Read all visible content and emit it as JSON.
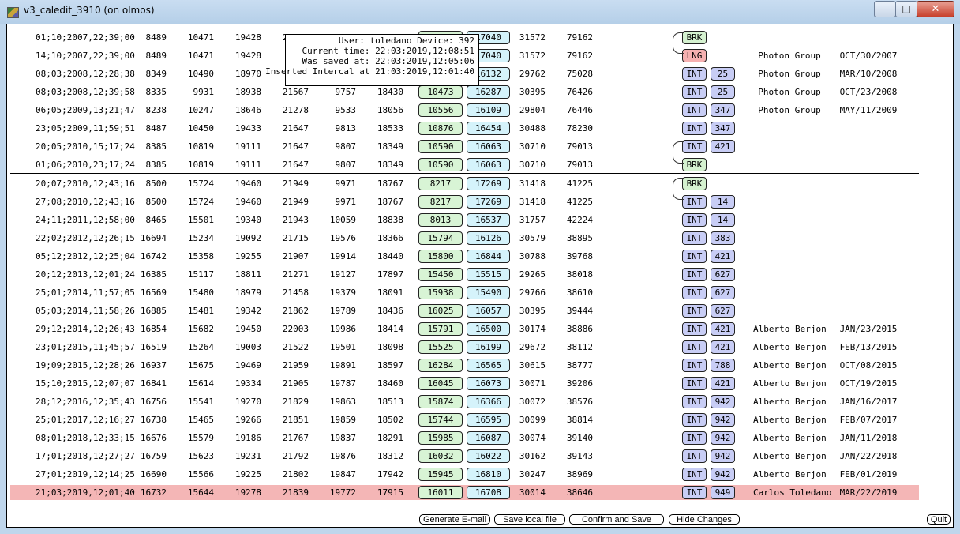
{
  "window": {
    "title": "v3_caledit_3910 (on olmos)",
    "minimize_glyph": "–",
    "maximize_glyph": "□",
    "close_glyph": "✕"
  },
  "rows": [
    {
      "ts": "01;10;2007,22;39;00",
      "v1": "8489",
      "v2": "10471",
      "v3": "19428",
      "v4": "21?47",
      "v5": "1??37",
      "v6": "18?37",
      "g": "?",
      "b": "17040",
      "v9": "31572",
      "v10": "79162",
      "t1": "BRK",
      "t2": "",
      "name": "",
      "date": ""
    },
    {
      "ts": "14;10;2007,22;39;00",
      "v1": "8489",
      "v2": "10471",
      "v3": "19428",
      "v4": "",
      "v5": "",
      "v6": "",
      "g": "",
      "b": "17040",
      "v9": "31572",
      "v10": "79162",
      "t1": "LNG",
      "t2": "",
      "name": "Photon Group",
      "date": "OCT/30/2007"
    },
    {
      "ts": "08;03;2008,12;28;38",
      "v1": "8349",
      "v2": "10490",
      "v3": "18970",
      "v4": "",
      "v5": "",
      "v6": "",
      "g": "",
      "b": "16132",
      "v9": "29762",
      "v10": "75028",
      "t1": "INT",
      "t2": "25",
      "name": "Photon Group",
      "date": "MAR/10/2008"
    },
    {
      "ts": "08;03;2008,12;39;58",
      "v1": "8335",
      "v2": "9931",
      "v3": "18938",
      "v4": "21567",
      "v5": "9757",
      "v6": "18430",
      "g": "10473",
      "b": "16287",
      "v9": "30395",
      "v10": "76426",
      "t1": "INT",
      "t2": "25",
      "name": "Photon Group",
      "date": "OCT/23/2008"
    },
    {
      "ts": "06;05;2009,13;21;47",
      "v1": "8238",
      "v2": "10247",
      "v3": "18646",
      "v4": "21278",
      "v5": "9533",
      "v6": "18056",
      "g": "10556",
      "b": "16109",
      "v9": "29804",
      "v10": "76446",
      "t1": "INT",
      "t2": "347",
      "name": "Photon Group",
      "date": "MAY/11/2009"
    },
    {
      "ts": "23;05;2009,11;59;51",
      "v1": "8487",
      "v2": "10450",
      "v3": "19433",
      "v4": "21647",
      "v5": "9813",
      "v6": "18533",
      "g": "10876",
      "b": "16454",
      "v9": "30488",
      "v10": "78230",
      "t1": "INT",
      "t2": "347",
      "name": "",
      "date": ""
    },
    {
      "ts": "20;05;2010,15;17;24",
      "v1": "8385",
      "v2": "10819",
      "v3": "19111",
      "v4": "21647",
      "v5": "9807",
      "v6": "18349",
      "g": "10590",
      "b": "16063",
      "v9": "30710",
      "v10": "79013",
      "t1": "INT",
      "t2": "421",
      "name": "",
      "date": ""
    },
    {
      "ts": "01;06;2010,23;17;24",
      "v1": "8385",
      "v2": "10819",
      "v3": "19111",
      "v4": "21647",
      "v5": "9807",
      "v6": "18349",
      "g": "10590",
      "b": "16063",
      "v9": "30710",
      "v10": "79013",
      "t1": "BRK",
      "t2": "",
      "name": "",
      "date": ""
    },
    {
      "ts": "20;07;2010,12;43;16",
      "v1": "8500",
      "v2": "15724",
      "v3": "19460",
      "v4": "21949",
      "v5": "9971",
      "v6": "18767",
      "g": "8217",
      "b": "17269",
      "v9": "31418",
      "v10": "41225",
      "t1": "BRK",
      "t2": "",
      "name": "",
      "date": ""
    },
    {
      "ts": "27;08;2010,12;43;16",
      "v1": "8500",
      "v2": "15724",
      "v3": "19460",
      "v4": "21949",
      "v5": "9971",
      "v6": "18767",
      "g": "8217",
      "b": "17269",
      "v9": "31418",
      "v10": "41225",
      "t1": "INT",
      "t2": "14",
      "name": "",
      "date": ""
    },
    {
      "ts": "24;11;2011,12;58;00",
      "v1": "8465",
      "v2": "15501",
      "v3": "19340",
      "v4": "21943",
      "v5": "10059",
      "v6": "18838",
      "g": "8013",
      "b": "16537",
      "v9": "31757",
      "v10": "42224",
      "t1": "INT",
      "t2": "14",
      "name": "",
      "date": ""
    },
    {
      "ts": "22;02;2012,12;26;15",
      "v1": "16694",
      "v2": "15234",
      "v3": "19092",
      "v4": "21715",
      "v5": "19576",
      "v6": "18366",
      "g": "15794",
      "b": "16126",
      "v9": "30579",
      "v10": "38895",
      "t1": "INT",
      "t2": "383",
      "name": "",
      "date": ""
    },
    {
      "ts": "05;12;2012,12;25;04",
      "v1": "16742",
      "v2": "15358",
      "v3": "19255",
      "v4": "21907",
      "v5": "19914",
      "v6": "18440",
      "g": "15800",
      "b": "16844",
      "v9": "30788",
      "v10": "39768",
      "t1": "INT",
      "t2": "421",
      "name": "",
      "date": ""
    },
    {
      "ts": "20;12;2013,12;01;24",
      "v1": "16385",
      "v2": "15117",
      "v3": "18811",
      "v4": "21271",
      "v5": "19127",
      "v6": "17897",
      "g": "15450",
      "b": "15515",
      "v9": "29265",
      "v10": "38018",
      "t1": "INT",
      "t2": "627",
      "name": "",
      "date": ""
    },
    {
      "ts": "25;01;2014,11;57;05",
      "v1": "16569",
      "v2": "15480",
      "v3": "18979",
      "v4": "21458",
      "v5": "19379",
      "v6": "18091",
      "g": "15938",
      "b": "15490",
      "v9": "29766",
      "v10": "38610",
      "t1": "INT",
      "t2": "627",
      "name": "",
      "date": ""
    },
    {
      "ts": "05;03;2014,11;58;26",
      "v1": "16885",
      "v2": "15481",
      "v3": "19342",
      "v4": "21862",
      "v5": "19789",
      "v6": "18436",
      "g": "16025",
      "b": "16057",
      "v9": "30395",
      "v10": "39444",
      "t1": "INT",
      "t2": "627",
      "name": "",
      "date": ""
    },
    {
      "ts": "29;12;2014,12;26;43",
      "v1": "16854",
      "v2": "15682",
      "v3": "19450",
      "v4": "22003",
      "v5": "19986",
      "v6": "18414",
      "g": "15791",
      "b": "16500",
      "v9": "30174",
      "v10": "38886",
      "t1": "INT",
      "t2": "421",
      "name": "Alberto Berjon",
      "date": "JAN/23/2015"
    },
    {
      "ts": "23;01;2015,11;45;57",
      "v1": "16519",
      "v2": "15264",
      "v3": "19003",
      "v4": "21522",
      "v5": "19501",
      "v6": "18098",
      "g": "15525",
      "b": "16199",
      "v9": "29672",
      "v10": "38112",
      "t1": "INT",
      "t2": "421",
      "name": "Alberto Berjon",
      "date": "FEB/13/2015"
    },
    {
      "ts": "19;09;2015,12;28;26",
      "v1": "16937",
      "v2": "15675",
      "v3": "19469",
      "v4": "21959",
      "v5": "19891",
      "v6": "18597",
      "g": "16284",
      "b": "16565",
      "v9": "30615",
      "v10": "38777",
      "t1": "INT",
      "t2": "788",
      "name": "Alberto Berjon",
      "date": "OCT/08/2015"
    },
    {
      "ts": "15;10;2015,12;07;07",
      "v1": "16841",
      "v2": "15614",
      "v3": "19334",
      "v4": "21905",
      "v5": "19787",
      "v6": "18460",
      "g": "16045",
      "b": "16073",
      "v9": "30071",
      "v10": "39206",
      "t1": "INT",
      "t2": "421",
      "name": "Alberto Berjon",
      "date": "OCT/19/2015"
    },
    {
      "ts": "28;12;2016,12;35;43",
      "v1": "16756",
      "v2": "15541",
      "v3": "19270",
      "v4": "21829",
      "v5": "19863",
      "v6": "18513",
      "g": "15874",
      "b": "16366",
      "v9": "30072",
      "v10": "38576",
      "t1": "INT",
      "t2": "942",
      "name": "Alberto Berjon",
      "date": "JAN/16/2017"
    },
    {
      "ts": "25;01;2017,12;16;27",
      "v1": "16738",
      "v2": "15465",
      "v3": "19266",
      "v4": "21851",
      "v5": "19859",
      "v6": "18502",
      "g": "15744",
      "b": "16595",
      "v9": "30099",
      "v10": "38814",
      "t1": "INT",
      "t2": "942",
      "name": "Alberto Berjon",
      "date": "FEB/07/2017"
    },
    {
      "ts": "08;01;2018,12;33;15",
      "v1": "16676",
      "v2": "15579",
      "v3": "19186",
      "v4": "21767",
      "v5": "19837",
      "v6": "18291",
      "g": "15985",
      "b": "16087",
      "v9": "30074",
      "v10": "39140",
      "t1": "INT",
      "t2": "942",
      "name": "Alberto Berjon",
      "date": "JAN/11/2018"
    },
    {
      "ts": "17;01;2018,12;27;27",
      "v1": "16759",
      "v2": "15623",
      "v3": "19231",
      "v4": "21792",
      "v5": "19876",
      "v6": "18312",
      "g": "16032",
      "b": "16022",
      "v9": "30162",
      "v10": "39143",
      "t1": "INT",
      "t2": "942",
      "name": "Alberto Berjon",
      "date": "JAN/22/2018"
    },
    {
      "ts": "27;01;2019,12;14;25",
      "v1": "16690",
      "v2": "15566",
      "v3": "19225",
      "v4": "21802",
      "v5": "19847",
      "v6": "17942",
      "g": "15945",
      "b": "16810",
      "v9": "30247",
      "v10": "38969",
      "t1": "INT",
      "t2": "942",
      "name": "Alberto Berjon",
      "date": "FEB/01/2019"
    },
    {
      "ts": "21;03;2019,12;01;40",
      "v1": "16732",
      "v2": "15644",
      "v3": "19278",
      "v4": "21839",
      "v5": "19772",
      "v6": "17915",
      "g": "16011",
      "b": "16708",
      "v9": "30014",
      "v10": "38646",
      "t1": "INT",
      "t2": "949",
      "name": "Carlos Toledano",
      "date": "MAR/22/2019"
    }
  ],
  "tooltip": {
    "line1": "User: toledano Device: 392",
    "line2": "Current time: 22:03:2019,12:08:51",
    "line3": "Was saved at: 22:03:2019,12:05:06",
    "line4": "Inserted Intercal at 21:03:2019,12:01:40"
  },
  "buttons": {
    "generate_email": "Generate E-mail",
    "save_local": "Save local file",
    "confirm_save": "Confirm and Save",
    "hide_changes": "Hide Changes",
    "quit": "Quit"
  },
  "colors": {
    "highlight_row": "#f4b6b6",
    "green_cell": "#d8f4d5",
    "blue_cell": "#d5f3fb",
    "int_tag": "#c8cdf5",
    "lng_tag": "#f6b1b1"
  }
}
